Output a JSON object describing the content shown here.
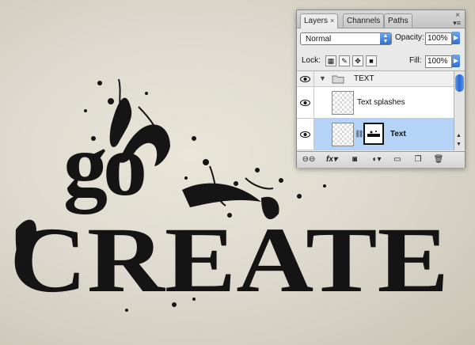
{
  "canvas": {
    "headline_top": "go",
    "headline_main": "CREATE",
    "ink_color": "#141414",
    "paper_color": "#e3e0d3"
  },
  "layers_panel": {
    "tabs": [
      {
        "label": "Layers",
        "active": true,
        "closable": true
      },
      {
        "label": "Channels",
        "active": false
      },
      {
        "label": "Paths",
        "active": false
      }
    ],
    "close_glyph": "×",
    "menu_glyph": "▾≡",
    "blend_mode": "Normal",
    "opacity_label": "Opacity:",
    "opacity_value": "100%",
    "lock_label": "Lock:",
    "fill_label": "Fill:",
    "fill_value": "100%",
    "lock_icons": [
      "lock-transparent-icon",
      "lock-image-icon",
      "lock-position-icon",
      "lock-all-icon"
    ],
    "layers": [
      {
        "name": "TEXT",
        "type": "group",
        "visible": true,
        "expanded": true
      },
      {
        "name": "Text splashes",
        "type": "layer",
        "visible": false
      },
      {
        "name": "Text",
        "type": "layer",
        "visible": true,
        "selected": true,
        "has_mask": true
      }
    ],
    "footer_icons": [
      "link-icon",
      "fx-icon",
      "add-mask-icon",
      "adjustment-layer-icon",
      "new-group-icon",
      "new-layer-icon",
      "trash-icon"
    ],
    "fx_label": "fx",
    "selected_color": "#b5d3f7"
  }
}
